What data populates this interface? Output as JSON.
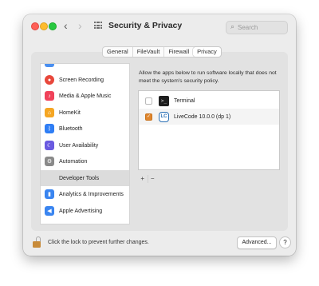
{
  "window": {
    "title": "Security & Privacy",
    "search_placeholder": "Search"
  },
  "tabs": [
    {
      "label": "General",
      "active": false
    },
    {
      "label": "FileVault",
      "active": false
    },
    {
      "label": "Firewall",
      "active": false
    },
    {
      "label": "Privacy",
      "active": true
    }
  ],
  "sidebar": {
    "items": [
      {
        "label": "",
        "icon": "partial-app-icon",
        "color": "#4a8ff0"
      },
      {
        "label": "Screen Recording",
        "icon": "record-icon",
        "color": "#e8473b"
      },
      {
        "label": "Media & Apple Music",
        "icon": "music-note-icon",
        "color": "#f0425a"
      },
      {
        "label": "HomeKit",
        "icon": "home-icon",
        "color": "#f5a623"
      },
      {
        "label": "Bluetooth",
        "icon": "bluetooth-icon",
        "color": "#2f7ef5"
      },
      {
        "label": "User Availability",
        "icon": "moon-icon",
        "color": "#6a5ae0"
      },
      {
        "label": "Automation",
        "icon": "gear-icon",
        "color": "#8a8a8a"
      },
      {
        "label": "Developer Tools",
        "icon": "",
        "color": "",
        "selected": true
      },
      {
        "label": "Analytics & Improvements",
        "icon": "bar-chart-icon",
        "color": "#3a85f0"
      },
      {
        "label": "Apple Advertising",
        "icon": "megaphone-icon",
        "color": "#3a85f0"
      }
    ]
  },
  "right_panel": {
    "description": "Allow the apps below to run software locally that does not meet the system's security policy.",
    "apps": [
      {
        "name": "Terminal",
        "checked": false,
        "icon": "terminal-icon"
      },
      {
        "name": "LiveCode 10.0.0 (dp 1)",
        "checked": true,
        "icon": "livecode-icon"
      }
    ],
    "add_label": "+",
    "remove_label": "−"
  },
  "footer": {
    "lock_text": "Click the lock to prevent further changes.",
    "advanced_label": "Advanced...",
    "help_label": "?"
  },
  "colors": {
    "checkbox_accent": "#e0862e"
  }
}
